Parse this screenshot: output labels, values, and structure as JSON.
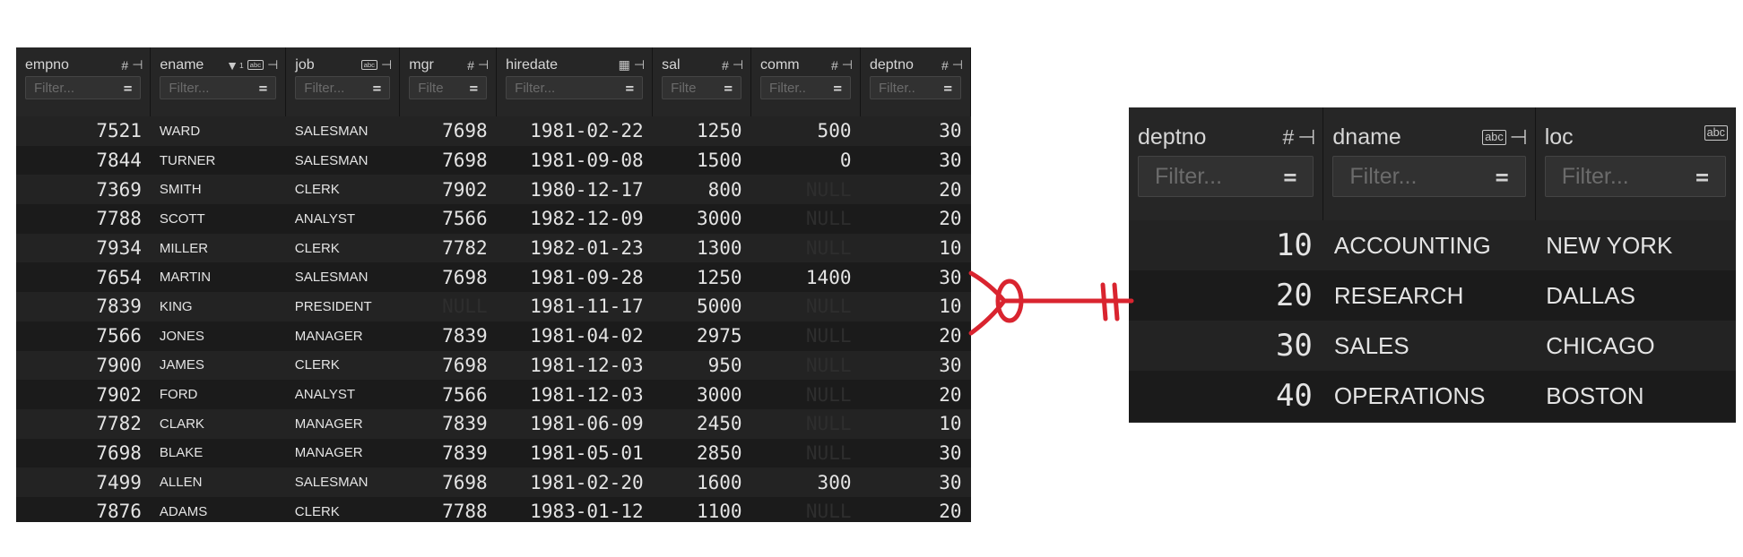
{
  "emp": {
    "columns": [
      {
        "name": "empno",
        "icons": [
          "hash-icon",
          "pin-icon"
        ],
        "filter_placeholder": "Filter..."
      },
      {
        "name": "ename",
        "icons": [
          "sort-desc-icon",
          "text-icon",
          "pin-icon"
        ],
        "filter_placeholder": "Filter..."
      },
      {
        "name": "job",
        "icons": [
          "text-icon",
          "pin-icon"
        ],
        "filter_placeholder": "Filter..."
      },
      {
        "name": "mgr",
        "icons": [
          "hash-icon",
          "pin-icon"
        ],
        "filter_placeholder": "Filte"
      },
      {
        "name": "hiredate",
        "icons": [
          "calendar-icon",
          "pin-icon"
        ],
        "filter_placeholder": "Filter..."
      },
      {
        "name": "sal",
        "icons": [
          "hash-icon",
          "pin-icon"
        ],
        "filter_placeholder": "Filte"
      },
      {
        "name": "comm",
        "icons": [
          "hash-icon",
          "pin-icon"
        ],
        "filter_placeholder": "Filter.."
      },
      {
        "name": "deptno",
        "icons": [
          "hash-icon",
          "pin-icon"
        ],
        "filter_placeholder": "Filter.."
      }
    ],
    "sort_indicator": "1",
    "rows": [
      [
        "7521",
        "WARD",
        "SALESMAN",
        "7698",
        "1981-02-22",
        "1250",
        "500",
        "30"
      ],
      [
        "7844",
        "TURNER",
        "SALESMAN",
        "7698",
        "1981-09-08",
        "1500",
        "0",
        "30"
      ],
      [
        "7369",
        "SMITH",
        "CLERK",
        "7902",
        "1980-12-17",
        "800",
        "NULL",
        "20"
      ],
      [
        "7788",
        "SCOTT",
        "ANALYST",
        "7566",
        "1982-12-09",
        "3000",
        "NULL",
        "20"
      ],
      [
        "7934",
        "MILLER",
        "CLERK",
        "7782",
        "1982-01-23",
        "1300",
        "NULL",
        "10"
      ],
      [
        "7654",
        "MARTIN",
        "SALESMAN",
        "7698",
        "1981-09-28",
        "1250",
        "1400",
        "30"
      ],
      [
        "7839",
        "KING",
        "PRESIDENT",
        "NULL",
        "1981-11-17",
        "5000",
        "NULL",
        "10"
      ],
      [
        "7566",
        "JONES",
        "MANAGER",
        "7839",
        "1981-04-02",
        "2975",
        "NULL",
        "20"
      ],
      [
        "7900",
        "JAMES",
        "CLERK",
        "7698",
        "1981-12-03",
        "950",
        "NULL",
        "30"
      ],
      [
        "7902",
        "FORD",
        "ANALYST",
        "7566",
        "1981-12-03",
        "3000",
        "NULL",
        "20"
      ],
      [
        "7782",
        "CLARK",
        "MANAGER",
        "7839",
        "1981-06-09",
        "2450",
        "NULL",
        "10"
      ],
      [
        "7698",
        "BLAKE",
        "MANAGER",
        "7839",
        "1981-05-01",
        "2850",
        "NULL",
        "30"
      ],
      [
        "7499",
        "ALLEN",
        "SALESMAN",
        "7698",
        "1981-02-20",
        "1600",
        "300",
        "30"
      ],
      [
        "7876",
        "ADAMS",
        "CLERK",
        "7788",
        "1983-01-12",
        "1100",
        "NULL",
        "20"
      ]
    ]
  },
  "dept": {
    "columns": [
      {
        "name": "deptno",
        "icons": [
          "hash-icon",
          "pin-icon"
        ],
        "filter_placeholder": "Filter..."
      },
      {
        "name": "dname",
        "icons": [
          "text-icon",
          "pin-icon"
        ],
        "filter_placeholder": "Filter..."
      },
      {
        "name": "loc",
        "icons": [
          "text-icon"
        ],
        "filter_placeholder": "Filter..."
      }
    ],
    "rows": [
      [
        "10",
        "ACCOUNTING",
        "NEW YORK"
      ],
      [
        "20",
        "RESEARCH",
        "DALLAS"
      ],
      [
        "30",
        "SALES",
        "CHICAGO"
      ],
      [
        "40",
        "OPERATIONS",
        "BOSTON"
      ]
    ]
  },
  "relationship": {
    "type": "many-to-one",
    "from": "emp.deptno",
    "to": "dept.deptno",
    "color": "#d9242f"
  },
  "colors": {
    "panel_bg": "#1f1f1f",
    "header_bg": "#262626",
    "text": "#e4e4e4",
    "connector": "#d9242f"
  }
}
